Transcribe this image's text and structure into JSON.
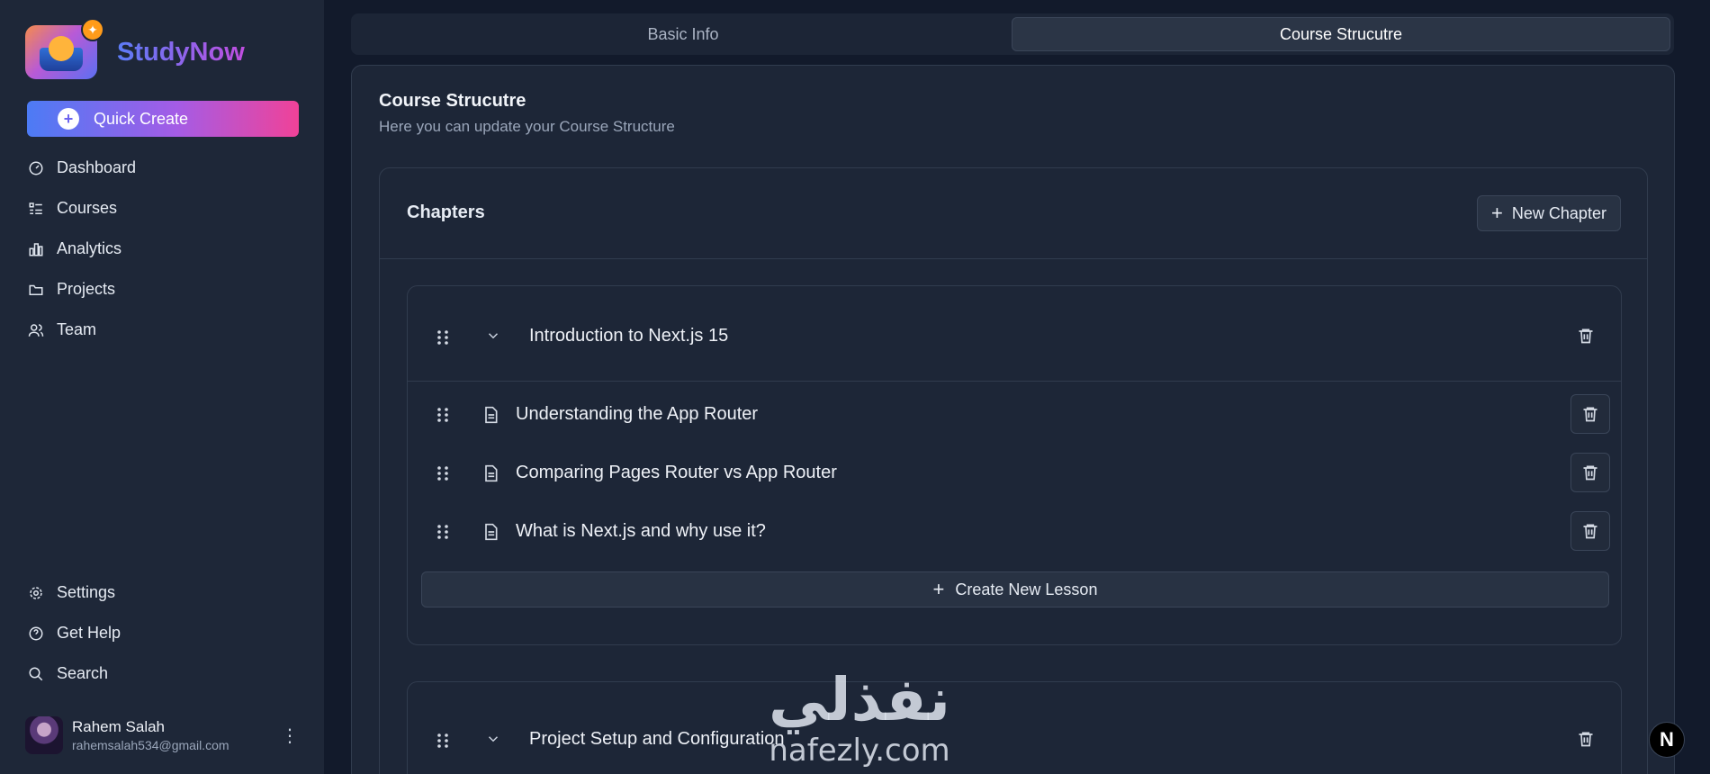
{
  "brand": {
    "name": "StudyNow"
  },
  "quick_create": {
    "label": "Quick Create"
  },
  "nav": {
    "main": [
      {
        "label": "Dashboard",
        "icon": "dashboard-icon"
      },
      {
        "label": "Courses",
        "icon": "list-icon"
      },
      {
        "label": "Analytics",
        "icon": "bar-chart-icon"
      },
      {
        "label": "Projects",
        "icon": "folder-icon"
      },
      {
        "label": "Team",
        "icon": "users-icon"
      }
    ],
    "secondary": [
      {
        "label": "Settings",
        "icon": "gear-icon"
      },
      {
        "label": "Get Help",
        "icon": "help-circle-icon"
      },
      {
        "label": "Search",
        "icon": "search-icon"
      }
    ]
  },
  "user": {
    "name": "Rahem Salah",
    "email": "rahemsalah534@gmail.com"
  },
  "tabs": [
    {
      "label": "Basic Info",
      "active": false
    },
    {
      "label": "Course Strucutre",
      "active": true
    }
  ],
  "card": {
    "title": "Course Strucutre",
    "subtitle": "Here you can update your Course Structure"
  },
  "chapters": {
    "title": "Chapters",
    "new_button": "New Chapter",
    "items": [
      {
        "title": "Introduction to Next.js 15",
        "expanded": true,
        "lessons": [
          "Understanding the App Router",
          "Comparing Pages Router vs App Router",
          "What is Next.js and why use it?"
        ],
        "create_lesson_label": "Create New Lesson"
      },
      {
        "title": "Project Setup and Configuration",
        "expanded": true
      }
    ]
  },
  "watermark": {
    "arabic": "نفذلي",
    "latin": "nafezly.com"
  },
  "next_badge": "N"
}
